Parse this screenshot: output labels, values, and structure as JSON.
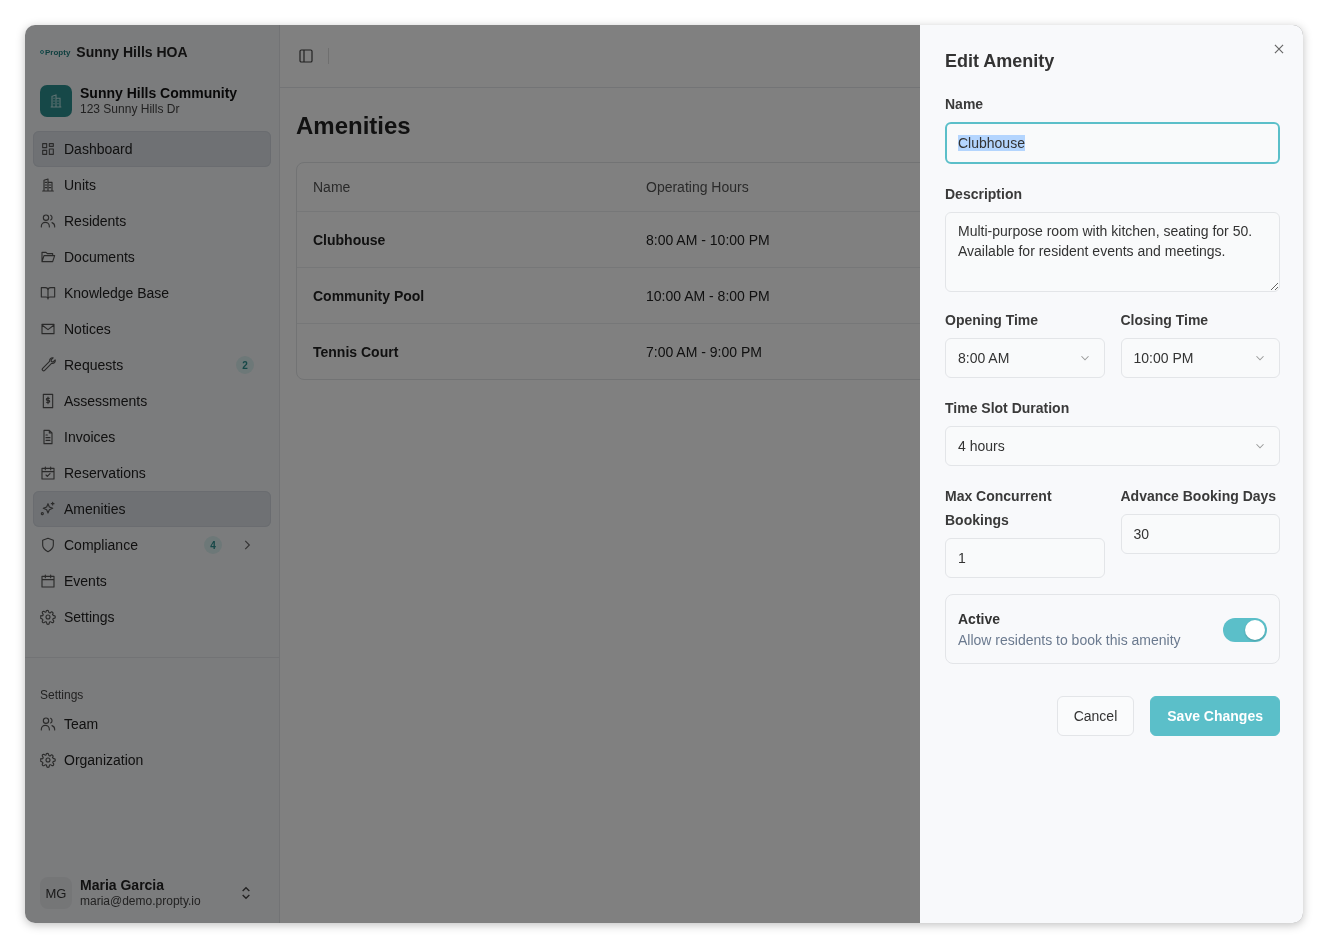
{
  "brand": {
    "logo_text": "Propty",
    "name": "Sunny Hills HOA"
  },
  "community": {
    "name": "Sunny Hills Community",
    "address": "123 Sunny Hills Dr"
  },
  "nav": [
    {
      "label": "Dashboard",
      "selected": true,
      "expandable": false
    },
    {
      "label": "Units",
      "selected": false,
      "expandable": false
    },
    {
      "label": "Residents",
      "selected": false,
      "expandable": false
    },
    {
      "label": "Documents",
      "selected": false,
      "expandable": false
    },
    {
      "label": "Knowledge Base",
      "selected": false,
      "expandable": false
    },
    {
      "label": "Notices",
      "selected": false,
      "expandable": false
    },
    {
      "label": "Requests",
      "selected": false,
      "expandable": false,
      "badge": "2"
    },
    {
      "label": "Assessments",
      "selected": false,
      "expandable": false
    },
    {
      "label": "Invoices",
      "selected": false,
      "expandable": false
    },
    {
      "label": "Reservations",
      "selected": false,
      "expandable": false
    },
    {
      "label": "Amenities",
      "selected": true,
      "expandable": false
    },
    {
      "label": "Compliance",
      "selected": false,
      "expandable": true,
      "badge": "4"
    },
    {
      "label": "Events",
      "selected": false,
      "expandable": false
    },
    {
      "label": "Settings",
      "selected": false,
      "expandable": false
    }
  ],
  "settings_section": {
    "heading": "Settings",
    "items": [
      {
        "label": "Team",
        "selected": false
      },
      {
        "label": "Organization",
        "selected": false
      }
    ]
  },
  "user": {
    "initials": "MG",
    "name": "Maria Garcia",
    "email": "maria@demo.propty.io"
  },
  "page": {
    "title": "Amenities",
    "table": {
      "columns": [
        "Name",
        "Operating Hours"
      ],
      "rows": [
        [
          "Clubhouse",
          "8:00 AM - 10:00 PM"
        ],
        [
          "Community Pool",
          "10:00 AM - 8:00 PM"
        ],
        [
          "Tennis Court",
          "7:00 AM - 9:00 PM"
        ]
      ]
    }
  },
  "drawer": {
    "title": "Edit Amenity",
    "name_field": {
      "label": "Name",
      "value": "Clubhouse",
      "focused": true
    },
    "description_field": {
      "label": "Description",
      "value": "Multi-purpose room with kitchen, seating for 50. Available for resident events and meetings."
    },
    "opening_time": {
      "label": "Opening Time",
      "value": "8:00 AM"
    },
    "closing_time": {
      "label": "Closing Time",
      "value": "10:00 PM"
    },
    "time_slot_duration": {
      "label": "Time Slot Duration",
      "value": "4 hours"
    },
    "max_concurrent_bookings": {
      "label": "Max Concurrent Bookings",
      "value": "1"
    },
    "advance_booking_days": {
      "label": "Advance Booking Days",
      "value": "30"
    },
    "active": {
      "label": "Active",
      "description": "Allow residents to book this amenity",
      "on": true
    },
    "buttons": [
      {
        "label": "Cancel",
        "kind": "secondary"
      },
      {
        "label": "Save Changes",
        "kind": "primary"
      }
    ]
  }
}
